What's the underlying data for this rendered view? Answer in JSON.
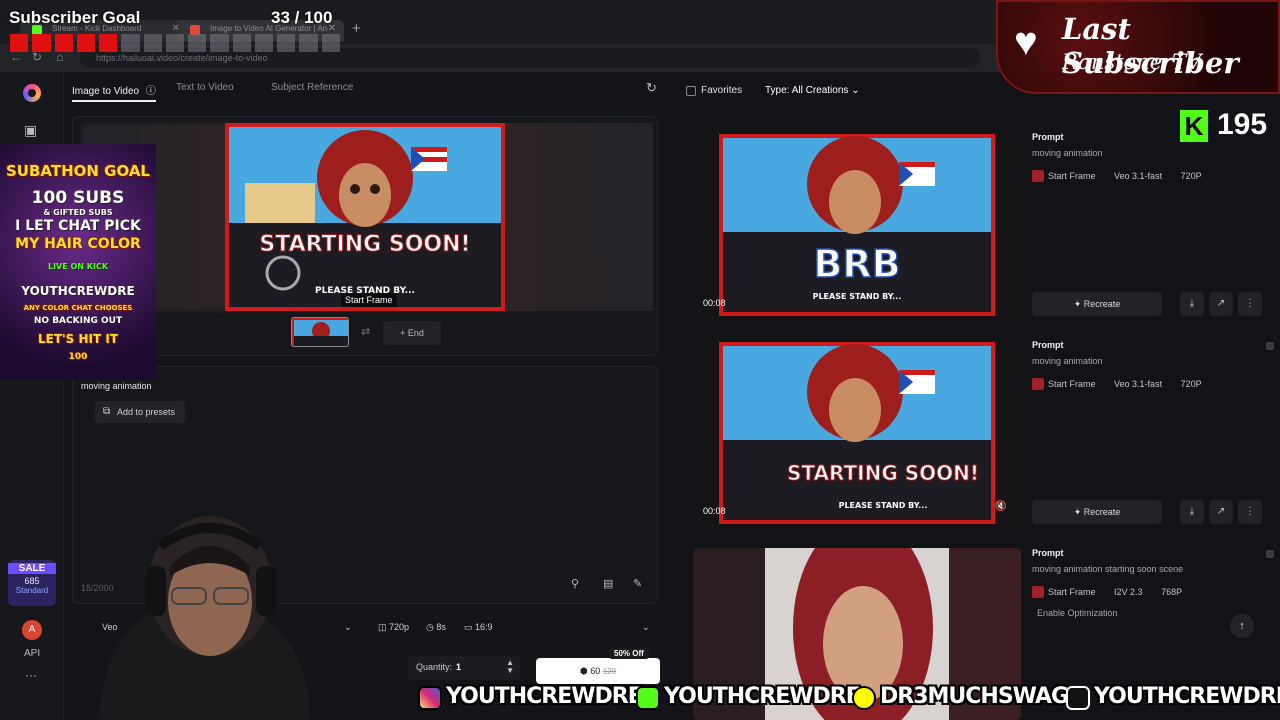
{
  "browser": {
    "tabs": [
      {
        "label": "Stream - Kick Dashboard",
        "favicon_color": "#53fc18"
      },
      {
        "label": "Image to Video AI Generator | An",
        "favicon_color": "#e8453c"
      }
    ],
    "url": "https://hailuoai.video/create/image-to-video"
  },
  "rail": {
    "sale": {
      "badge": "SALE",
      "amount": "685",
      "plan": "Standard"
    },
    "avatar_letter": "A",
    "api_label": "API",
    "more": "···"
  },
  "creator": {
    "tabs": [
      {
        "label": "Image to Video",
        "active": true
      },
      {
        "label": "Text to Video",
        "active": false
      },
      {
        "label": "Subject Reference",
        "active": false
      }
    ],
    "start_frame_label": "Start Frame",
    "end_button": "+ End",
    "prompt_value": "moving animation",
    "presets_button": "Add to presets",
    "char_count": "18/2000",
    "settings": {
      "model": "Veo",
      "resolution": "720p",
      "duration": "8s",
      "ratio": "16:9"
    },
    "quantity_label": "Quantity:",
    "quantity_value": "1",
    "credits": "60",
    "credits_old": "120",
    "discount": "50% Off"
  },
  "panel": {
    "favorites_label": "Favorites",
    "type_label": "Type:",
    "type_value": "All Creations",
    "cards": [
      {
        "duration": "00:08",
        "prompt_label": "Prompt",
        "prompt": "moving animation",
        "frame": "Start Frame",
        "model": "Veo 3.1-fast",
        "quality": "720P",
        "recreate": "Recreate",
        "overlay_text": "BRB",
        "sub_text": "PLEASE STAND BY..."
      },
      {
        "duration": "00:08",
        "prompt_label": "Prompt",
        "prompt": "moving animation",
        "frame": "Start Frame",
        "model": "Veo 3.1-fast",
        "quality": "720P",
        "recreate": "Recreate",
        "overlay_text": "STARTING SOON!",
        "sub_text": "PLEASE STAND BY..."
      },
      {
        "duration": "",
        "prompt_label": "Prompt",
        "prompt": "moving animation starting soon scene",
        "frame": "Start Frame",
        "model": "I2V 2.3",
        "quality": "768P",
        "optimization": "Enable Optimization"
      }
    ]
  },
  "stream": {
    "sub_goal_title": "Subscriber Goal",
    "sub_goal_count": "33 / 100",
    "sub_goal_progress": 0.33,
    "last_sub_title": "Last Subscriber",
    "last_sub_name": "RanstonerTV",
    "kick_letter": "K",
    "kick_followers": "195",
    "poster": {
      "line1": "SUBATHON GOAL",
      "line2": "100 SUBS",
      "line2b": "& GIFTED SUBS",
      "line3": "I LET CHAT PICK",
      "line4": "MY HAIR COLOR",
      "line5": "LIVE ON KICK",
      "line6": "YOUTHCREWDRE",
      "line7": "ANY COLOR CHAT CHOOSES",
      "line8": "NO BACKING OUT",
      "line9": "LET'S HIT IT",
      "line10": "100"
    },
    "socials": [
      {
        "handle": "YOUTHCREWDRE",
        "color": "#e1306c"
      },
      {
        "handle": "YOUTHCREWDRE",
        "color": "#53fc18"
      },
      {
        "handle": "DR3MUCHSWAG",
        "color": "#fffc00"
      },
      {
        "handle": "YOUTHCREWDRE",
        "color": "#ffffff"
      }
    ]
  },
  "thumbnail": {
    "headline": "STARTING SOON!",
    "sub": "PLEASE STAND BY..."
  }
}
